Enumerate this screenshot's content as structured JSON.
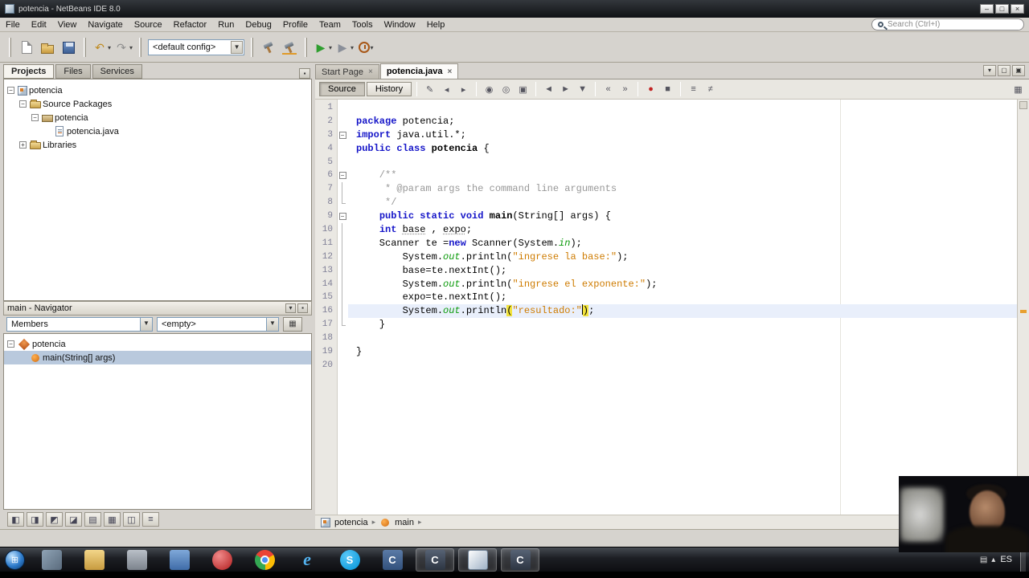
{
  "window": {
    "title": "potencia - NetBeans IDE 8.0",
    "controls": [
      {
        "name": "minimize-button",
        "glyph": "–"
      },
      {
        "name": "maximize-button",
        "glyph": "□"
      },
      {
        "name": "close-button",
        "glyph": "×"
      }
    ]
  },
  "menubar": {
    "items": [
      "File",
      "Edit",
      "View",
      "Navigate",
      "Source",
      "Refactor",
      "Run",
      "Debug",
      "Profile",
      "Team",
      "Tools",
      "Window",
      "Help"
    ]
  },
  "search": {
    "placeholder": "Search (Ctrl+I)"
  },
  "main_toolbar": {
    "buttons": [
      {
        "grip": true
      },
      {
        "name": "new-file-button",
        "icon": "new-file-icon"
      },
      {
        "name": "open-project-button",
        "icon": "open-project-icon"
      },
      {
        "name": "save-all-button",
        "icon": "save-all-icon"
      },
      {
        "grip": true
      },
      {
        "name": "undo-button",
        "icon": "undo-icon",
        "glyph": "↶",
        "color": "#bf8a1f",
        "dropdown": true
      },
      {
        "name": "redo-button",
        "icon": "redo-icon",
        "glyph": "↷",
        "color": "#8f8f8f",
        "dropdown": true
      },
      {
        "grip": true
      },
      {
        "kind": "select",
        "name": "config-select",
        "value": "<default config>"
      },
      {
        "grip": true
      },
      {
        "name": "build-project-button",
        "icon": "hammer-icon"
      },
      {
        "name": "clean-build-button",
        "icon": "clean-hammer-icon"
      },
      {
        "grip": true
      },
      {
        "name": "run-project-button",
        "icon": "run-icon",
        "glyph": "▶",
        "color": "#2f9e2f",
        "dropdown": true
      },
      {
        "name": "debug-project-button",
        "icon": "debug-icon",
        "glyph": "▶",
        "color": "#8a8f99",
        "dropdown": true
      },
      {
        "name": "profile-project-button",
        "icon": "profile-icon",
        "dropdown": true
      }
    ]
  },
  "projects_panel": {
    "tabs": [
      {
        "label": "Projects",
        "active": true
      },
      {
        "label": "Files",
        "active": false
      },
      {
        "label": "Services",
        "active": false
      }
    ],
    "collapse_icon": {
      "name": "collapse-panel-icon",
      "glyph": "▪"
    },
    "tree": [
      {
        "depth": 0,
        "expand": "-",
        "icon": "project",
        "label": "potencia"
      },
      {
        "depth": 1,
        "expand": "-",
        "icon": "folder",
        "label": "Source Packages"
      },
      {
        "depth": 2,
        "expand": "-",
        "icon": "package",
        "label": "potencia"
      },
      {
        "depth": 3,
        "expand": "",
        "icon": "java-file",
        "label": "potencia.java"
      },
      {
        "depth": 1,
        "expand": "+",
        "icon": "folder",
        "label": "Libraries"
      }
    ]
  },
  "navigator_panel": {
    "title": "main - Navigator",
    "members_label": "Members",
    "scope_label": "<empty>",
    "header_icons": [
      {
        "name": "sort-navigator-icon",
        "glyph": "▾"
      },
      {
        "name": "close-navigator-icon",
        "glyph": "▪"
      }
    ],
    "grid_button_glyph": "▦",
    "tree": [
      {
        "depth": 0,
        "expand": "-",
        "icon": "class",
        "label": "potencia"
      },
      {
        "depth": 1,
        "expand": "",
        "icon": "method",
        "label": "main(String[] args)",
        "selected": true
      }
    ]
  },
  "left_bottom_toolbar": {
    "icons": [
      {
        "name": "dock-left-icon",
        "glyph": "◧"
      },
      {
        "name": "dock-right-icon",
        "glyph": "◨"
      },
      {
        "name": "dock-top-icon",
        "glyph": "◩"
      },
      {
        "name": "dock-bottom-icon",
        "glyph": "◪"
      },
      {
        "name": "output-window-icon",
        "glyph": "▤"
      },
      {
        "name": "grid-window-icon",
        "glyph": "▦"
      },
      {
        "name": "split-window-icon",
        "glyph": "◫"
      },
      {
        "name": "list-window-icon",
        "glyph": "≡"
      }
    ]
  },
  "editor": {
    "tabs": [
      {
        "label": "Start Page",
        "active": false
      },
      {
        "label": "potencia.java",
        "active": true
      }
    ],
    "window_icons": [
      {
        "name": "minimize-window-icon",
        "glyph": "▾"
      },
      {
        "name": "float-window-icon",
        "glyph": "▢"
      },
      {
        "name": "maximize-window-icon",
        "glyph": "▣"
      }
    ],
    "toolbar": {
      "source": "Source",
      "history": "History",
      "icons": [
        {
          "name": "last-edit-icon",
          "glyph": "✎"
        },
        {
          "name": "back-icon",
          "glyph": "◂"
        },
        {
          "name": "forward-icon",
          "glyph": "▸"
        },
        {
          "sep": true
        },
        {
          "name": "find-selection-icon",
          "glyph": "◉"
        },
        {
          "name": "find-occurrence-icon",
          "glyph": "◎"
        },
        {
          "name": "toggle-highlight-icon",
          "glyph": "▣"
        },
        {
          "sep": true
        },
        {
          "name": "previous-bookmark-icon",
          "glyph": "◄"
        },
        {
          "name": "next-bookmark-icon",
          "glyph": "►"
        },
        {
          "name": "toggle-bookmark-icon",
          "glyph": "▼"
        },
        {
          "sep": true
        },
        {
          "name": "shift-left-icon",
          "glyph": "«"
        },
        {
          "name": "shift-right-icon",
          "glyph": "»"
        },
        {
          "sep": true
        },
        {
          "name": "start-macro-icon",
          "glyph": "●",
          "color": "#c22222"
        },
        {
          "name": "stop-macro-icon",
          "glyph": "■"
        },
        {
          "sep": true
        },
        {
          "name": "comment-icon",
          "glyph": "≡"
        },
        {
          "name": "uncomment-icon",
          "glyph": "≠"
        }
      ],
      "split_icon": {
        "name": "split-document-icon",
        "glyph": "▦"
      }
    },
    "breadcrumb": [
      {
        "icon": "project",
        "label": "potencia"
      },
      {
        "icon": "method",
        "label": "main"
      }
    ],
    "code": {
      "lines": [
        {
          "n": 1,
          "segs": []
        },
        {
          "n": 2,
          "segs": [
            [
              "k",
              "package"
            ],
            [
              "p",
              " potencia;"
            ]
          ]
        },
        {
          "n": 3,
          "fold": "-",
          "segs": [
            [
              "k",
              "import"
            ],
            [
              "p",
              " java.util.*;"
            ]
          ]
        },
        {
          "n": 4,
          "segs": [
            [
              "k",
              "public"
            ],
            [
              "p",
              " "
            ],
            [
              "k",
              "class"
            ],
            [
              "p",
              " "
            ],
            [
              "b",
              "potencia"
            ],
            [
              "p",
              " {"
            ]
          ]
        },
        {
          "n": 5,
          "segs": []
        },
        {
          "n": 6,
          "fold": "-",
          "segs": [
            [
              "c",
              "    /**"
            ]
          ]
        },
        {
          "n": 7,
          "fold": "|",
          "segs": [
            [
              "c",
              "     * @param args the command line arguments"
            ]
          ]
        },
        {
          "n": 8,
          "fold": "L",
          "segs": [
            [
              "c",
              "     */"
            ]
          ]
        },
        {
          "n": 9,
          "fold": "-",
          "segs": [
            [
              "p",
              "    "
            ],
            [
              "k",
              "public"
            ],
            [
              "p",
              " "
            ],
            [
              "k",
              "static"
            ],
            [
              "p",
              " "
            ],
            [
              "k",
              "void"
            ],
            [
              "p",
              " "
            ],
            [
              "b",
              "main"
            ],
            [
              "p",
              "(String[] args) {"
            ]
          ]
        },
        {
          "n": 10,
          "fold": "|",
          "segs": [
            [
              "p",
              "    "
            ],
            [
              "k",
              "int"
            ],
            [
              "p",
              " "
            ],
            [
              "u",
              "base"
            ],
            [
              "p",
              " , "
            ],
            [
              "u",
              "expo"
            ],
            [
              "p",
              ";"
            ]
          ]
        },
        {
          "n": 11,
          "fold": "|",
          "segs": [
            [
              "p",
              "    Scanner te ="
            ],
            [
              "k",
              "new"
            ],
            [
              "p",
              " Scanner(System."
            ],
            [
              "f",
              "in"
            ],
            [
              "p",
              ");"
            ]
          ]
        },
        {
          "n": 12,
          "fold": "|",
          "segs": [
            [
              "p",
              "        System."
            ],
            [
              "f",
              "out"
            ],
            [
              "p",
              ".println("
            ],
            [
              "s",
              "\"ingrese la base:\""
            ],
            [
              "p",
              ");"
            ]
          ]
        },
        {
          "n": 13,
          "fold": "|",
          "segs": [
            [
              "p",
              "        base=te.nextInt();"
            ]
          ]
        },
        {
          "n": 14,
          "fold": "|",
          "segs": [
            [
              "p",
              "        System."
            ],
            [
              "f",
              "out"
            ],
            [
              "p",
              ".println("
            ],
            [
              "s",
              "\"ingrese el exponente:\""
            ],
            [
              "p",
              ");"
            ]
          ]
        },
        {
          "n": 15,
          "fold": "|",
          "segs": [
            [
              "p",
              "        expo=te.nextInt();"
            ]
          ]
        },
        {
          "n": 16,
          "fold": "|",
          "current": true,
          "segs": [
            [
              "p",
              "        System."
            ],
            [
              "f",
              "out"
            ],
            [
              "p",
              ".println"
            ],
            [
              "hk",
              "("
            ],
            [
              "s",
              "\"resultado:\""
            ],
            [
              "caret",
              ""
            ],
            [
              "hk",
              ")"
            ],
            [
              "p",
              ";"
            ]
          ]
        },
        {
          "n": 17,
          "fold": "L",
          "segs": [
            [
              "p",
              "    }"
            ]
          ]
        },
        {
          "n": 18,
          "segs": []
        },
        {
          "n": 19,
          "segs": [
            [
              "p",
              "}"
            ]
          ]
        },
        {
          "n": 20,
          "segs": []
        }
      ]
    }
  },
  "taskbar": {
    "start_glyph": "⊞",
    "icons": [
      {
        "name": "taskbar-app-media",
        "shape": "square",
        "bg": "linear-gradient(135deg,#8fa3b5,#5a6b7d)"
      },
      {
        "name": "taskbar-app-folder",
        "shape": "square",
        "bg": "linear-gradient(#f3d689,#c79b3f)"
      },
      {
        "name": "taskbar-app-gray",
        "shape": "square",
        "bg": "linear-gradient(#b9bfc7,#7c838d)"
      },
      {
        "name": "taskbar-app-blue",
        "shape": "square",
        "bg": "linear-gradient(#7fa8d9,#3f6ca8)"
      },
      {
        "name": "taskbar-media-player-red",
        "shape": "circle",
        "bg": "radial-gradient(circle at 35% 30%,#f08a8a,#b21d1d)"
      },
      {
        "name": "taskbar-chrome",
        "shape": "circle",
        "cls": "chrome"
      },
      {
        "name": "taskbar-internet-explorer",
        "shape": "square",
        "cls": "ie",
        "letter": "e"
      },
      {
        "name": "taskbar-skype",
        "shape": "circle",
        "bg": "radial-gradient(circle at 35% 30%,#59c8f7,#0092d8)",
        "letter": "S"
      },
      {
        "name": "taskbar-app-c",
        "shape": "square",
        "bg": "linear-gradient(#5a7aa6,#32517c)",
        "letter": "C"
      },
      {
        "name": "taskbar-dev-cpp",
        "shape": "square",
        "bg": "linear-gradient(#566274,#2d3542)",
        "letter": "C",
        "active": true
      },
      {
        "name": "taskbar-netbeans",
        "shape": "square",
        "cls": "netbeans",
        "active": true
      },
      {
        "name": "taskbar-dev-cpp-2",
        "shape": "square",
        "bg": "linear-gradient(#566274,#2d3542)",
        "letter": "C",
        "active": true
      }
    ],
    "tray": {
      "language": "ES",
      "icons": [
        {
          "name": "tray-keyboard-icon",
          "glyph": "▤"
        },
        {
          "name": "tray-show-hidden-icon",
          "glyph": "▴"
        }
      ]
    }
  }
}
